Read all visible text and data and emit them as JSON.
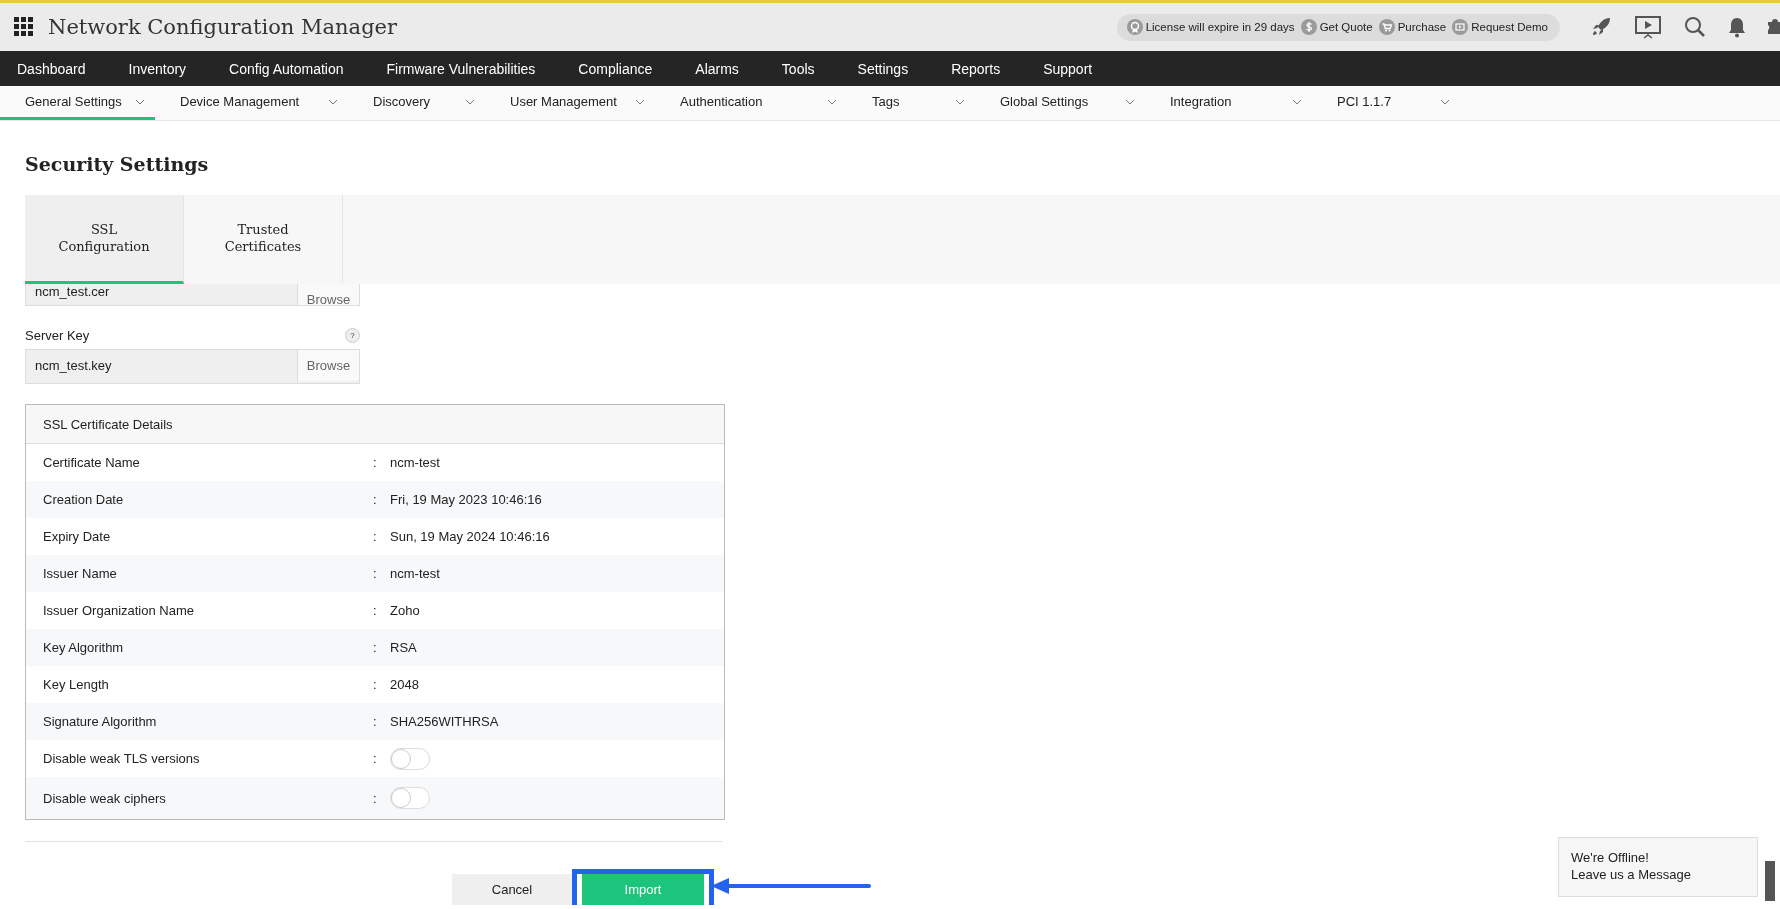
{
  "header": {
    "title": "Network Configuration Manager",
    "links": [
      {
        "kind": "license",
        "label": "License will expire in 29 days"
      },
      {
        "kind": "quote",
        "label": "Get Quote"
      },
      {
        "kind": "purchase",
        "label": "Purchase"
      },
      {
        "kind": "demo",
        "label": "Request Demo"
      }
    ]
  },
  "main_nav": [
    {
      "label": "Dashboard"
    },
    {
      "label": "Inventory"
    },
    {
      "label": "Config Automation"
    },
    {
      "label": "Firmware Vulnerabilities"
    },
    {
      "label": "Compliance"
    },
    {
      "label": "Alarms"
    },
    {
      "label": "Tools"
    },
    {
      "label": "Settings"
    },
    {
      "label": "Reports"
    },
    {
      "label": "Support"
    }
  ],
  "sub_nav": [
    {
      "label": "General Settings",
      "selected": true
    },
    {
      "label": "Device Management",
      "selected": false
    },
    {
      "label": "Discovery",
      "selected": false
    },
    {
      "label": "User Management",
      "selected": false
    },
    {
      "label": "Authentication",
      "selected": false
    },
    {
      "label": "Tags",
      "selected": false
    },
    {
      "label": "Global Settings",
      "selected": false
    },
    {
      "label": "Integration",
      "selected": false
    },
    {
      "label": "PCI 1.1.7",
      "selected": false
    }
  ],
  "page": {
    "title": "Security Settings",
    "tabs": [
      {
        "label": "SSL Configuration",
        "selected": true
      },
      {
        "label": "Trusted Certificates",
        "selected": false
      }
    ],
    "certificate_field": {
      "value": "ncm_test.cer",
      "button": "Browse"
    },
    "server_key": {
      "label": "Server Key",
      "help": "?",
      "value": "ncm_test.key",
      "button": "Browse"
    },
    "details": {
      "title": "SSL Certificate Details",
      "rows": [
        {
          "kind": "text",
          "label": "Certificate Name",
          "separator": ":",
          "value": "ncm-test"
        },
        {
          "kind": "text",
          "label": "Creation Date",
          "separator": ":",
          "value": "Fri, 19 May 2023 10:46:16"
        },
        {
          "kind": "text",
          "label": "Expiry Date",
          "separator": ":",
          "value": "Sun, 19 May 2024 10:46:16"
        },
        {
          "kind": "text",
          "label": "Issuer Name",
          "separator": ":",
          "value": "ncm-test"
        },
        {
          "kind": "text",
          "label": "Issuer Organization Name",
          "separator": ":",
          "value": "Zoho"
        },
        {
          "kind": "text",
          "label": "Key Algorithm",
          "separator": ":",
          "value": "RSA"
        },
        {
          "kind": "text",
          "label": "Key Length",
          "separator": ":",
          "value": "2048"
        },
        {
          "kind": "text",
          "label": "Signature Algorithm",
          "separator": ":",
          "value": "SHA256WITHRSA"
        },
        {
          "kind": "toggle",
          "label": "Disable weak TLS versions",
          "separator": ":",
          "on": false
        },
        {
          "kind": "toggle",
          "label": "Disable weak ciphers",
          "separator": ":",
          "on": false
        }
      ]
    },
    "buttons": [
      {
        "kind": "cancel",
        "label": "Cancel",
        "highlighted": false
      },
      {
        "kind": "primary",
        "label": "Import",
        "highlighted": true
      }
    ]
  },
  "chat": {
    "lines": [
      "We're Offline!",
      "Leave us a Message"
    ]
  }
}
